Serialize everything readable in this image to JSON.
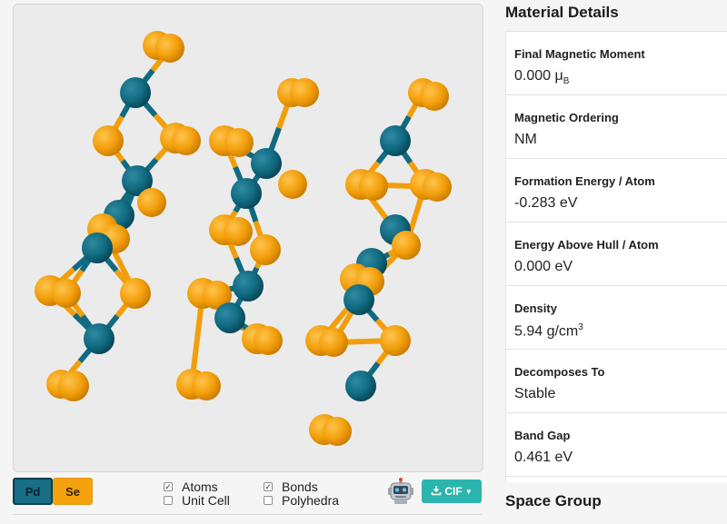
{
  "legend": {
    "pd": "Pd",
    "se": "Se"
  },
  "toggles": {
    "atoms": {
      "label": "Atoms",
      "checked": true
    },
    "unit_cell": {
      "label": "Unit Cell",
      "checked": false
    },
    "bonds": {
      "label": "Bonds",
      "checked": true
    },
    "polyhedra": {
      "label": "Polyhedra",
      "checked": false
    }
  },
  "download": {
    "label": "CIF"
  },
  "colors": {
    "pd": "#106a80",
    "se": "#f29e0a",
    "cif": "#2cb5ae"
  },
  "side": {
    "title": "Material Details",
    "next_title": "Space Group",
    "details": [
      {
        "label": "Final Magnetic Moment",
        "value": "0.000 μ",
        "sub": "B",
        "sup": ""
      },
      {
        "label": "Magnetic Ordering",
        "value": "NM",
        "sub": "",
        "sup": ""
      },
      {
        "label": "Formation Energy / Atom",
        "value": "-0.283 eV",
        "sub": "",
        "sup": ""
      },
      {
        "label": "Energy Above Hull / Atom",
        "value": "0.000 eV",
        "sub": "",
        "sup": ""
      },
      {
        "label": "Density",
        "value": "5.94 g/cm",
        "sub": "",
        "sup": "3"
      },
      {
        "label": "Decomposes To",
        "value": "Stable",
        "sub": "",
        "sup": ""
      },
      {
        "label": "Band Gap",
        "value": "0.461 eV",
        "sub": "",
        "sup": ""
      }
    ]
  },
  "icons": {
    "robot": "robot-icon",
    "download": "download-icon",
    "caret": "caret-down-icon"
  }
}
